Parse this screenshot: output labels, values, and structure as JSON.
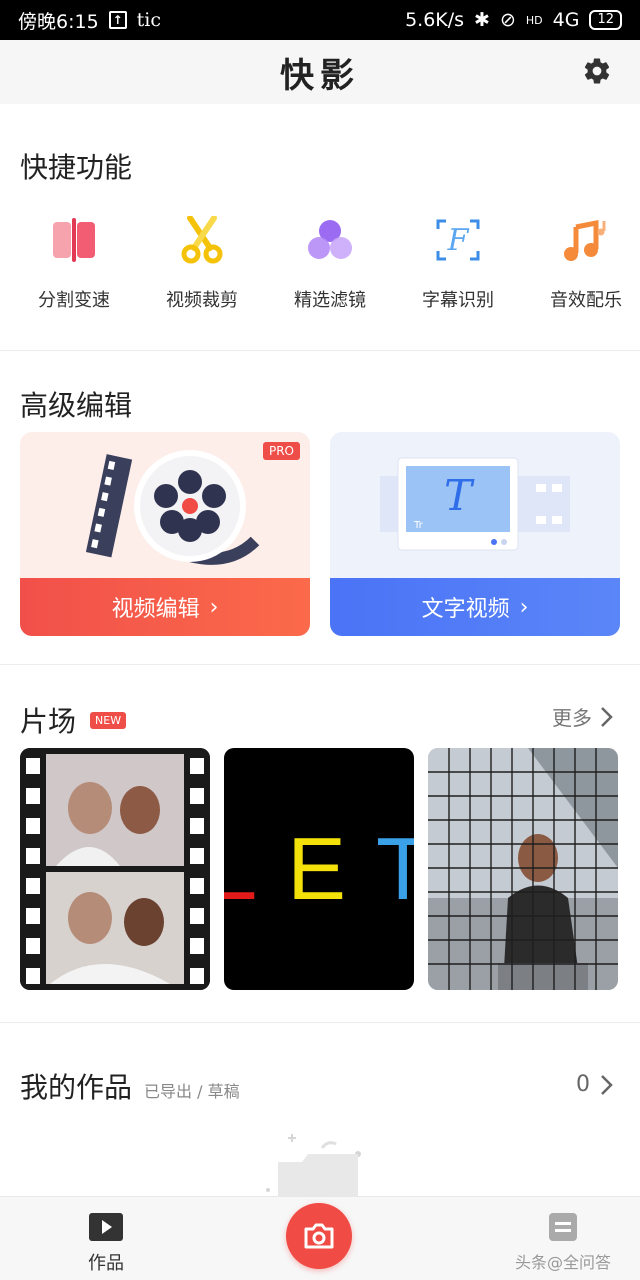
{
  "status_bar": {
    "time": "傍晚6:15",
    "app_name": "tic",
    "net_speed": "5.6K/s",
    "hd": "HD",
    "network": "4G",
    "battery": "12"
  },
  "header": {
    "title": "快影"
  },
  "quick": {
    "title": "快捷功能",
    "items": [
      {
        "label": "分割变速",
        "icon": "split-icon"
      },
      {
        "label": "视频裁剪",
        "icon": "scissors-icon"
      },
      {
        "label": "精选滤镜",
        "icon": "filter-icon"
      },
      {
        "label": "字幕识别",
        "icon": "subtitle-icon"
      },
      {
        "label": "音效配乐",
        "icon": "music-icon"
      }
    ]
  },
  "advanced": {
    "title": "高级编辑",
    "cards": [
      {
        "label": "视频编辑",
        "badge": "PRO",
        "arrow": "›"
      },
      {
        "label": "文字视频",
        "arrow": "›"
      }
    ]
  },
  "studio": {
    "title": "片场",
    "badge": "NEW",
    "more": "更多",
    "thumbs": [
      {
        "name": "film-strip-couple"
      },
      {
        "name": "let-text",
        "letters": [
          "L",
          "E",
          "T"
        ],
        "colors": [
          "#e31a1a",
          "#f5e10a",
          "#3aa0e8"
        ]
      },
      {
        "name": "grid-girl-laughing"
      }
    ]
  },
  "works": {
    "title": "我的作品",
    "subtitle": "已导出 / 草稿",
    "count": "0"
  },
  "bottom_nav": {
    "works_label": "作品",
    "right_label": "头条@全问答"
  },
  "colors": {
    "accent_red": "#f04b45",
    "accent_blue": "#4a73f6"
  }
}
